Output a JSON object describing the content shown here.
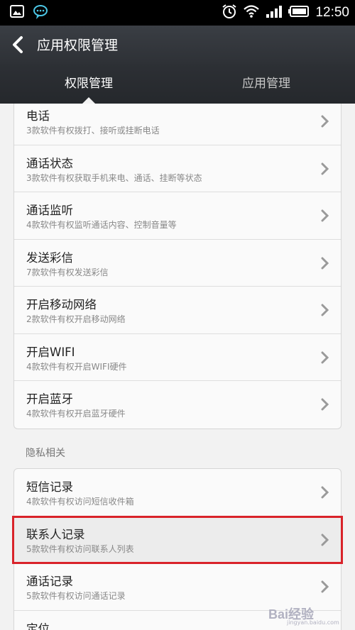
{
  "status_bar": {
    "time": "12:50",
    "left_icons": [
      "image-icon",
      "chat-bubble-icon"
    ],
    "right_icons": [
      "alarm-icon",
      "wifi-icon",
      "signal-icon",
      "battery-icon"
    ]
  },
  "header": {
    "title": "应用权限管理",
    "back_icon": "chevron-left-icon"
  },
  "tabs": [
    {
      "label": "权限管理",
      "active": true
    },
    {
      "label": "应用管理",
      "active": false
    }
  ],
  "permissions": [
    {
      "title": "电话",
      "subtitle": "3款软件有权拨打、接听或挂断电话"
    },
    {
      "title": "通话状态",
      "subtitle": "3款软件有权获取手机来电、通话、挂断等状态"
    },
    {
      "title": "通话监听",
      "subtitle": "4款软件有权监听通话内容、控制音量等"
    },
    {
      "title": "发送彩信",
      "subtitle": "7款软件有权发送彩信"
    },
    {
      "title": "开启移动网络",
      "subtitle": "2款软件有权开启移动网络"
    },
    {
      "title": "开启WIFI",
      "subtitle": "4款软件有权开启WIFI硬件"
    },
    {
      "title": "开启蓝牙",
      "subtitle": "4款软件有权开启蓝牙硬件"
    }
  ],
  "privacy_section": {
    "label": "隐私相关",
    "items": [
      {
        "title": "短信记录",
        "subtitle": "4款软件有权访问短信收件箱"
      },
      {
        "title": "联系人记录",
        "subtitle": "5款软件有权访问联系人列表",
        "highlighted": true
      },
      {
        "title": "通话记录",
        "subtitle": "5款软件有权访问通话记录"
      },
      {
        "title": "定位",
        "subtitle": ""
      }
    ]
  },
  "colors": {
    "title_bar": "#34373c",
    "highlight_border": "#d9232a",
    "background": "#f2f2f2"
  },
  "watermark": {
    "text": "Bai经验",
    "sub": "jingyan.baidu.com"
  }
}
